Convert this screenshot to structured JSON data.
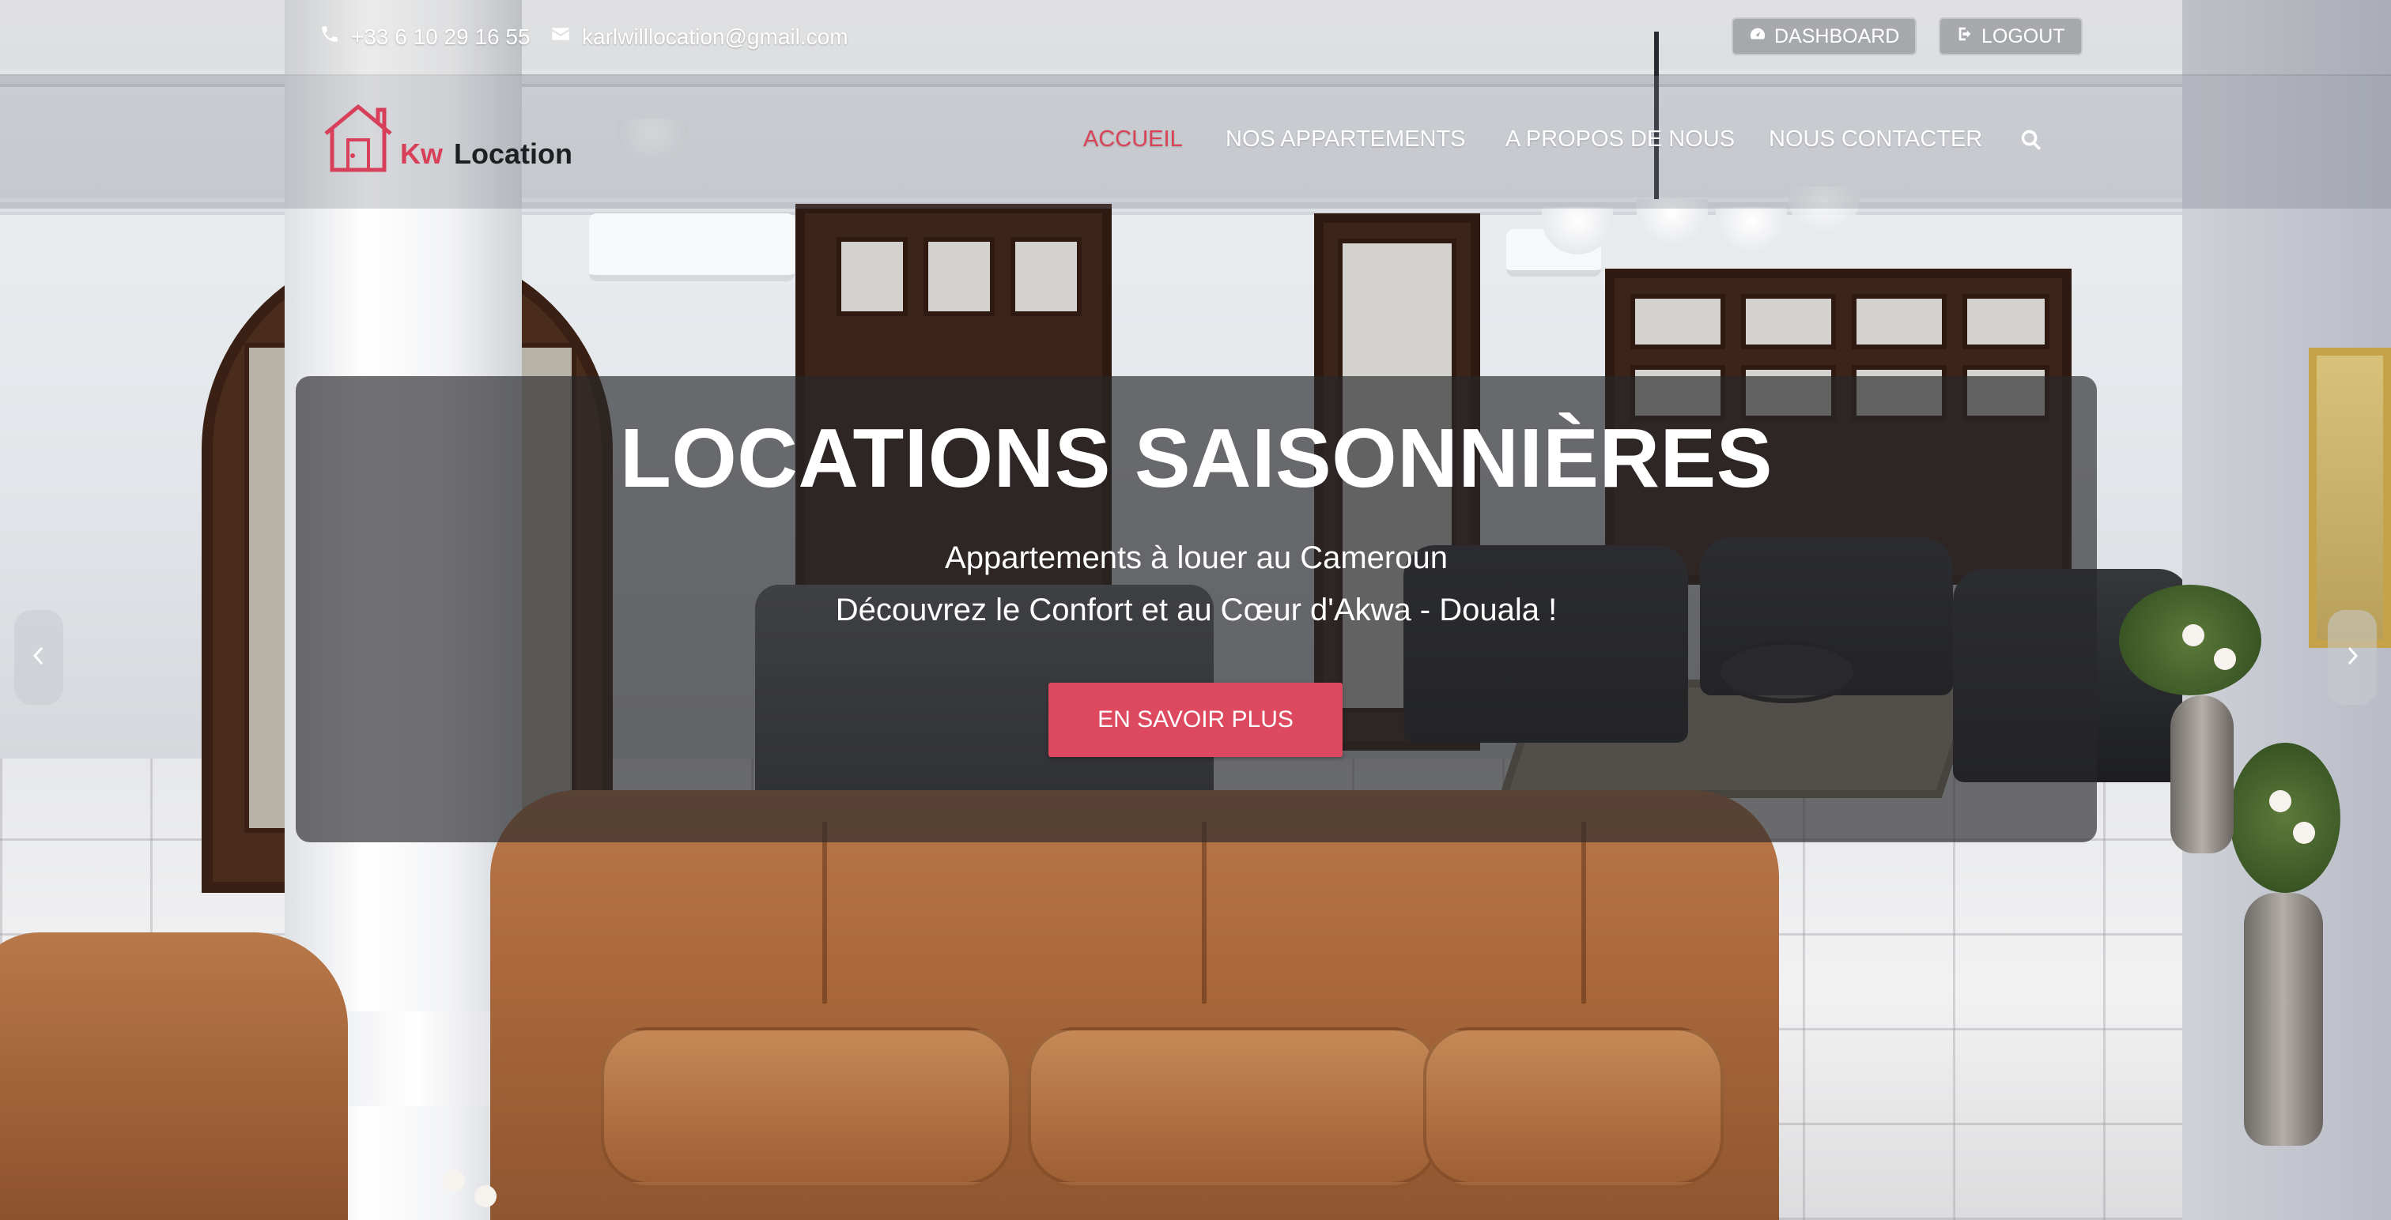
{
  "topbar": {
    "phone": "+33 6 10 29 16 55",
    "email": "karlwilllocation@gmail.com",
    "dashboard_label": "DASHBOARD",
    "logout_label": "LOGOUT"
  },
  "logo": {
    "part1": "Kw",
    "part2": "Location"
  },
  "nav": {
    "items": [
      {
        "label": "ACCUEIL",
        "active": true
      },
      {
        "label": "NOS APPARTEMENTS",
        "active": false
      },
      {
        "label": "A PROPOS DE NOUS",
        "active": false
      },
      {
        "label": "NOUS CONTACTER",
        "active": false
      }
    ]
  },
  "hero": {
    "title": "LOCATIONS SAISONNIÈRES",
    "subtitle_1": "Appartements à louer au Cameroun",
    "subtitle_2": "Découvrez le Confort et au Cœur d'Akwa - Douala !",
    "cta_label": "EN SAVOIR PLUS"
  },
  "colors": {
    "accent": "#dd4a60",
    "nav_active": "#d84455",
    "panel_overlay": "#282828"
  },
  "icons": {
    "phone": "phone-icon",
    "email": "envelope-icon",
    "dashboard": "dashboard-gauge-icon",
    "logout": "logout-icon",
    "search": "search-icon",
    "prev": "chevron-left-icon",
    "next": "chevron-right-icon"
  }
}
